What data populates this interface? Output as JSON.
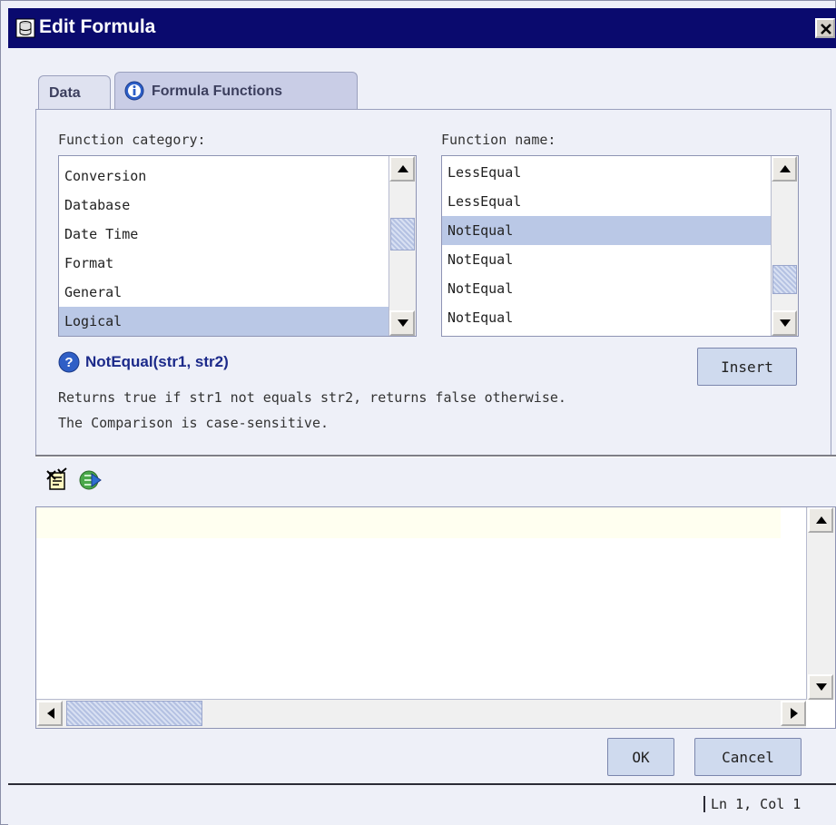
{
  "window": {
    "title": "Edit Formula",
    "close_icon": "close-icon"
  },
  "tabs": [
    {
      "label": "Data",
      "active": false
    },
    {
      "label": "Formula Functions",
      "active": true,
      "icon": "info-icon"
    }
  ],
  "function_category": {
    "label": "Function category:",
    "items": [
      "Conversion",
      "Database",
      "Date Time",
      "Format",
      "General",
      "Logical"
    ],
    "selected": "Logical"
  },
  "function_name": {
    "label": "Function name:",
    "items": [
      "LessEqual",
      "LessEqual",
      "NotEqual",
      "NotEqual",
      "NotEqual",
      "NotEqual"
    ],
    "selected_index": 2
  },
  "insert_button": {
    "label": "Insert"
  },
  "function_help": {
    "signature": "NotEqual(str1, str2)",
    "description_line1": "Returns true if str1 not equals str2, returns false otherwise.",
    "description_line2": "The Comparison is case-sensitive."
  },
  "editor_toolbar": [
    {
      "name": "syntax-check-icon"
    },
    {
      "name": "evaluate-icon"
    }
  ],
  "editor": {
    "text": ""
  },
  "buttons": {
    "ok": "OK",
    "cancel": "Cancel"
  },
  "status": {
    "position": "Ln   1, Col 1"
  },
  "colors": {
    "title_bar": "#0a0a6e",
    "selection": "#bac8e6",
    "button": "#cfdaee",
    "background": "#eef0f8"
  }
}
